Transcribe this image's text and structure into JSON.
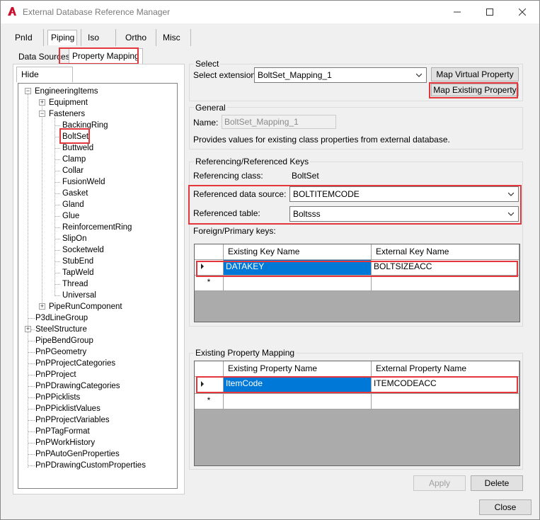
{
  "window": {
    "title": "External Database Reference Manager"
  },
  "top_tabs": [
    "PnId",
    "Piping",
    "Iso",
    "Ortho",
    "Misc"
  ],
  "sub_tabs": [
    "Data Sources",
    "Property Mapping"
  ],
  "hide_unused_label": "Hide Unused",
  "tree": {
    "root": "EngineeringItems",
    "level1": [
      "Equipment",
      "Fasteners"
    ],
    "fasteners_children": [
      "BackingRing",
      "BoltSet",
      "Buttweld",
      "Clamp",
      "Collar",
      "FusionWeld",
      "Gasket",
      "Gland",
      "Glue",
      "ReinforcementRing",
      "SlipOn",
      "Socketweld",
      "StubEnd",
      "TapWeld",
      "Thread",
      "Universal"
    ],
    "pipe_run": "PipeRunComponent",
    "top_level": [
      "P3dLineGroup",
      "SteelStructure",
      "PipeBendGroup",
      "PnPGeometry",
      "PnPProjectCategories",
      "PnPProject",
      "PnPDrawingCategories",
      "PnPPicklists",
      "PnPPicklistValues",
      "PnPProjectVariables",
      "PnPTagFormat",
      "PnPWorkHistory",
      "PnPAutoGenProperties",
      "PnPDrawingCustomProperties"
    ]
  },
  "select": {
    "group_label": "Select",
    "extension_label": "Select extension",
    "extension_value": "BoltSet_Mapping_1",
    "map_virtual": "Map Virtual Property",
    "map_existing": "Map Existing Property"
  },
  "general": {
    "group_label": "General",
    "name_label": "Name:",
    "name_value": "BoltSet_Mapping_1",
    "description": "Provides values for existing class properties from external database."
  },
  "keys": {
    "group_label": "Referencing/Referenced Keys",
    "referencing_class_label": "Referencing class:",
    "referencing_class_value": "BoltSet",
    "ref_source_label": "Referenced data source:",
    "ref_source_value": "BOLTITEMCODE",
    "ref_table_label": "Referenced table:",
    "ref_table_value": "Boltsss",
    "fk_label": "Foreign/Primary keys:",
    "columns": [
      "Existing Key Name",
      "External Key Name"
    ],
    "rows": [
      [
        "DATAKEY",
        "BOLTSIZEACC"
      ]
    ]
  },
  "mapping": {
    "group_label": "Existing Property Mapping",
    "columns": [
      "Existing Property Name",
      "External Property Name"
    ],
    "rows": [
      [
        "ItemCode",
        "ITEMCODEACC"
      ]
    ]
  },
  "buttons": {
    "apply": "Apply",
    "delete": "Delete",
    "close": "Close"
  },
  "colors": {
    "selection": "#0078d7",
    "highlight": "#e4373d",
    "app_icon": "#c8102e"
  }
}
